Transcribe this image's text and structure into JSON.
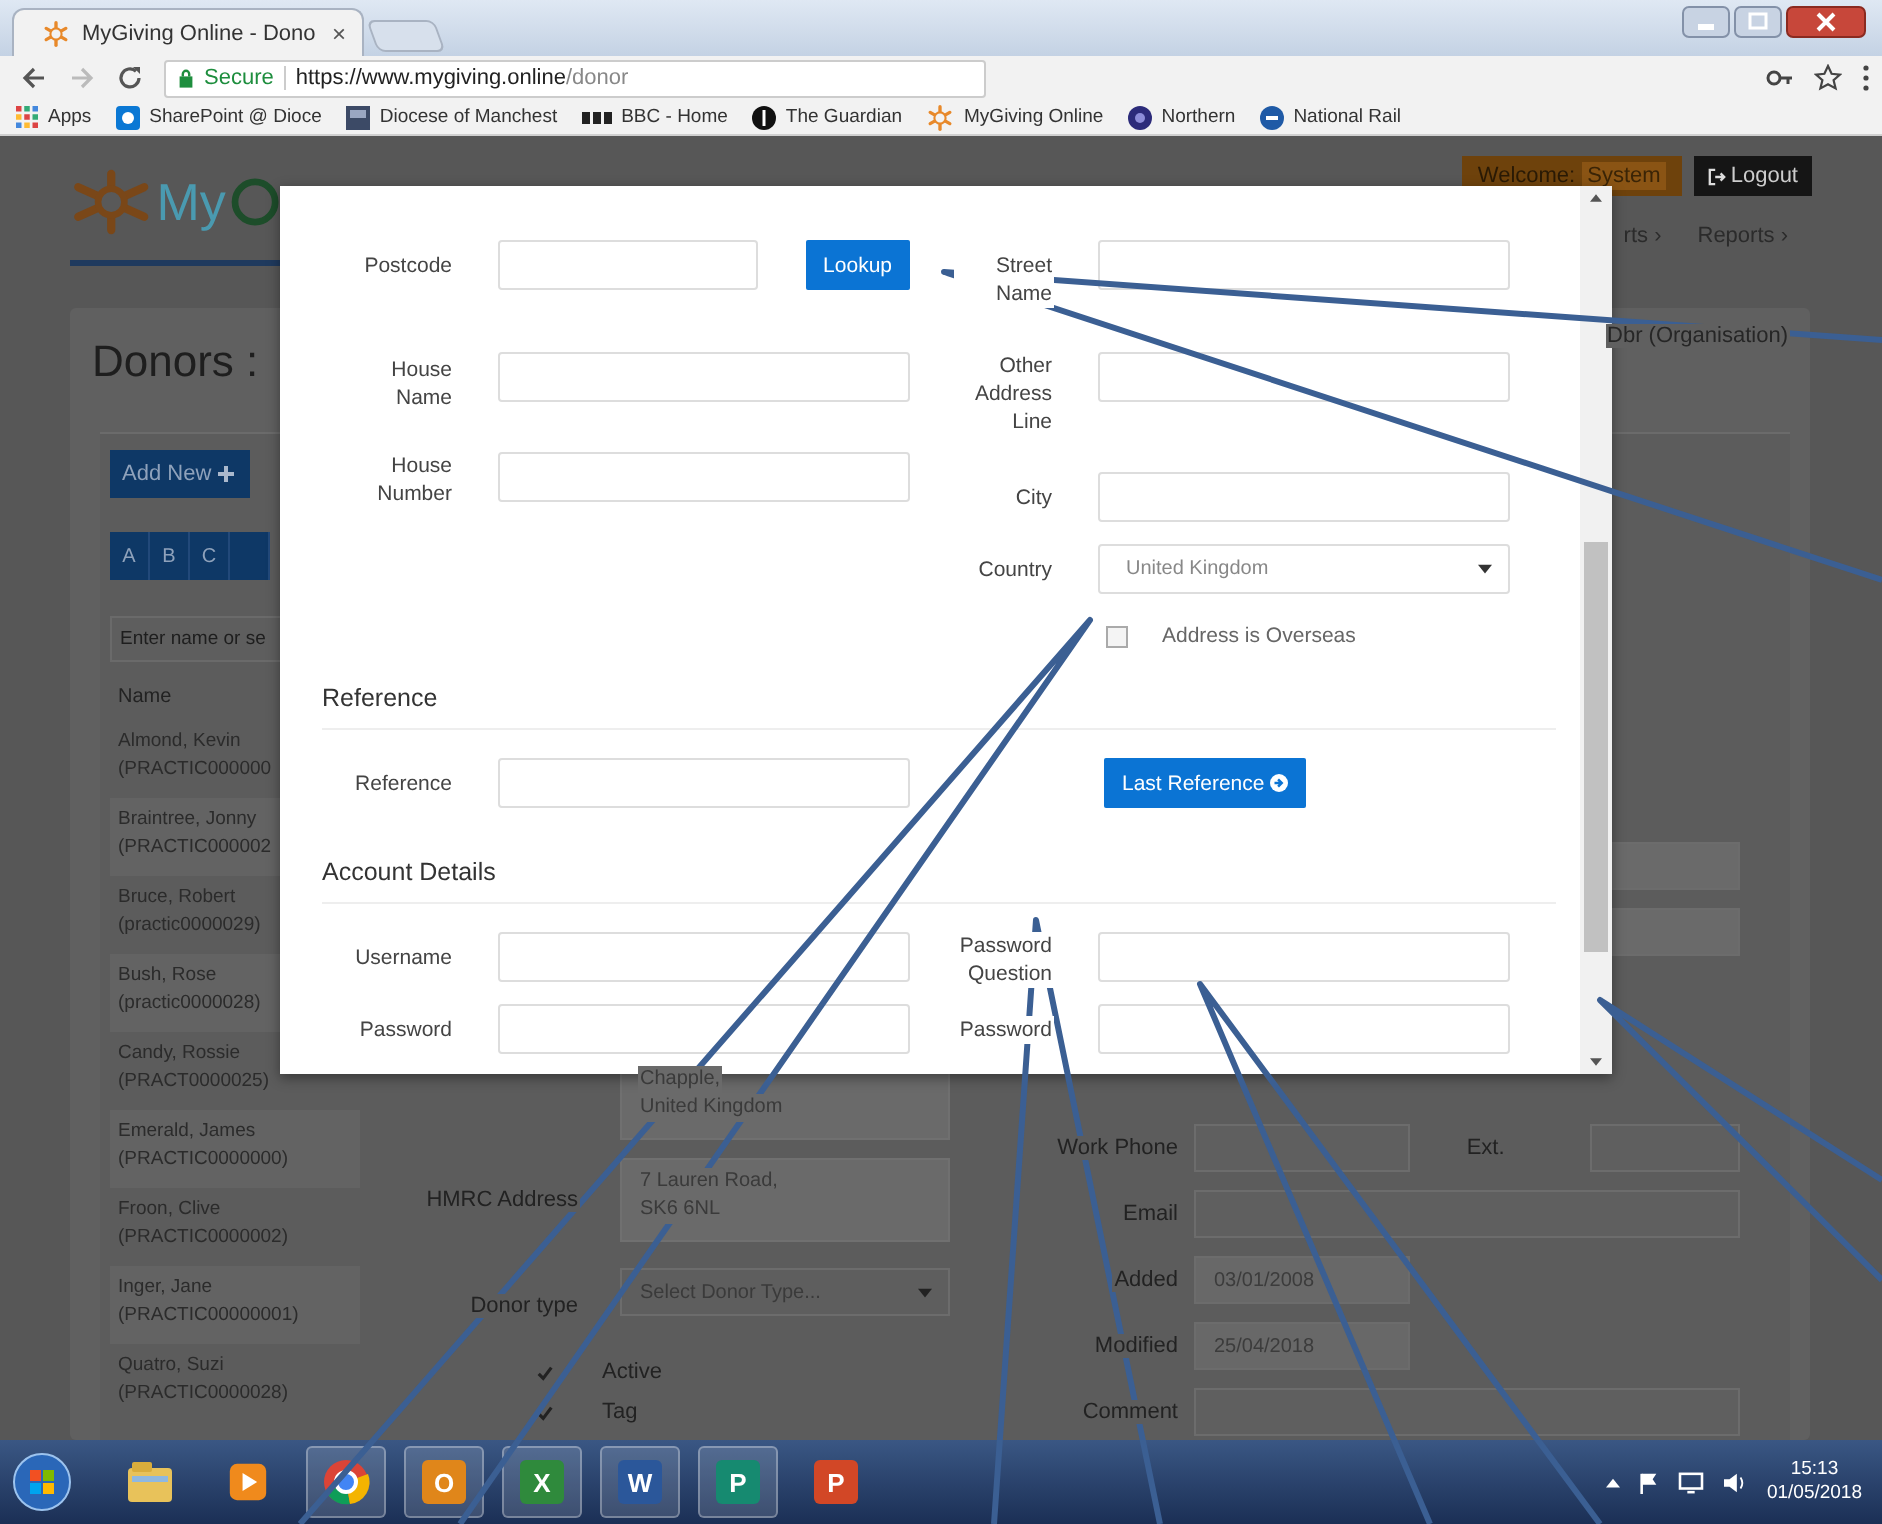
{
  "browser": {
    "tab_title": "MyGiving Online - Dono",
    "tab_close": "×",
    "secure_label": "Secure",
    "url_host": "https://www.mygiving.online",
    "url_path": "/donor",
    "bookmarks": [
      {
        "kind": "apps",
        "label": "Apps"
      },
      {
        "kind": "sharepoint",
        "label": "SharePoint @ Dioce"
      },
      {
        "kind": "diocese",
        "label": "Diocese of Manchest"
      },
      {
        "kind": "bbc",
        "label": "BBC - Home"
      },
      {
        "kind": "guardian",
        "label": "The Guardian"
      },
      {
        "kind": "mygiving",
        "label": "MyGiving Online"
      },
      {
        "kind": "northern",
        "label": "Northern"
      },
      {
        "kind": "rail",
        "label": "National Rail"
      }
    ]
  },
  "page": {
    "logo_text": "My",
    "welcome_label": "Welcome:",
    "welcome_user": "System",
    "logout": "Logout",
    "nav": [
      {
        "label": "rts ›"
      },
      {
        "label": "Reports ›"
      }
    ],
    "title": "Donors :",
    "organisation": "Dbr (Organisation)",
    "add_new": "Add New",
    "letters": [
      "A",
      "B",
      "C"
    ],
    "search_placeholder": "Enter name or se",
    "name_header": "Name",
    "donors": [
      {
        "name": "Almond, Kevin",
        "ref": "(PRACTIC000000"
      },
      {
        "name": "Braintree, Jonny",
        "ref": "(PRACTIC000002"
      },
      {
        "name": "Bruce, Robert",
        "ref": "(practic0000029)"
      },
      {
        "name": "Bush, Rose",
        "ref": "(practic0000028)"
      },
      {
        "name": "Candy, Rossie",
        "ref": "(PRACT0000025)"
      },
      {
        "name": "Emerald, James",
        "ref": "(PRACTIC0000000)"
      },
      {
        "name": "Froon, Clive",
        "ref": "(PRACTIC0000002)"
      },
      {
        "name": "Inger, Jane",
        "ref": "(PRACTIC00000001)"
      },
      {
        "name": "Quatro, Suzi",
        "ref": "(PRACTIC0000028)"
      }
    ],
    "form_left": [
      {
        "kind": "textarea",
        "lines": [
          "Chapple,",
          "United Kingdom"
        ]
      },
      {
        "kind": "textarea",
        "label": "HMRC Address",
        "lines": [
          "7 Lauren Road,",
          "SK6 6NL"
        ]
      },
      {
        "kind": "select",
        "label": "Donor type",
        "value": "Select Donor Type..."
      },
      {
        "kind": "checkbox",
        "label": "Active",
        "checked": true
      },
      {
        "kind": "checkbox",
        "label": "Tag",
        "checked": true
      }
    ],
    "form_right": [
      {
        "kind": "blank"
      },
      {
        "kind": "blank"
      },
      {
        "kind": "phone",
        "label": "Work Phone",
        "ext_label": "Ext."
      },
      {
        "kind": "input",
        "label": "Email"
      },
      {
        "kind": "short",
        "label": "Added",
        "value": "03/01/2008"
      },
      {
        "kind": "short",
        "label": "Modified",
        "value": "25/04/2018"
      },
      {
        "kind": "input",
        "label": "Comment"
      }
    ]
  },
  "modal": {
    "sections": [
      {
        "rows": [
          {
            "left": {
              "kind": "postcode",
              "label": "Postcode",
              "button": "Lookup"
            },
            "right": {
              "kind": "input",
              "label": "Street Name"
            }
          },
          {
            "left": {
              "kind": "input",
              "label": "House Name"
            },
            "right": {
              "kind": "input",
              "label": "Other Address Line"
            }
          },
          {
            "left": {
              "kind": "input",
              "label": "House Number"
            },
            "right": {
              "kind": "input",
              "label": "City"
            }
          },
          {
            "right": {
              "kind": "select",
              "label": "Country",
              "value": "United Kingdom"
            }
          },
          {
            "right": {
              "kind": "checkbox",
              "label": "Address is Overseas",
              "checked": false
            }
          }
        ]
      },
      {
        "title": "Reference",
        "rows": [
          {
            "left": {
              "kind": "input",
              "label": "Reference"
            },
            "right": {
              "kind": "button",
              "label": "Last Reference"
            }
          }
        ]
      },
      {
        "title": "Account Details",
        "rows": [
          {
            "left": {
              "kind": "input",
              "label": "Username"
            },
            "right": {
              "kind": "input",
              "label": "Password Question"
            }
          },
          {
            "left": {
              "kind": "input",
              "label": "Password"
            },
            "right": {
              "kind": "input",
              "label": "Password"
            }
          }
        ]
      }
    ]
  },
  "taskbar": {
    "apps": [
      {
        "kind": "folder",
        "running": false
      },
      {
        "kind": "media",
        "running": false
      },
      {
        "kind": "chrome",
        "running": true
      },
      {
        "kind": "letter",
        "glyph": "O",
        "color": "#e0861a",
        "running": true
      },
      {
        "kind": "letter",
        "glyph": "X",
        "color": "#2f8a3c",
        "running": true
      },
      {
        "kind": "letter",
        "glyph": "W",
        "color": "#2b579a",
        "running": true
      },
      {
        "kind": "letter",
        "glyph": "P",
        "color": "#168a70",
        "running": true
      },
      {
        "kind": "letter",
        "glyph": "P",
        "color": "#d24726",
        "running": false
      }
    ],
    "time": "15:13",
    "date": "01/05/2018"
  }
}
